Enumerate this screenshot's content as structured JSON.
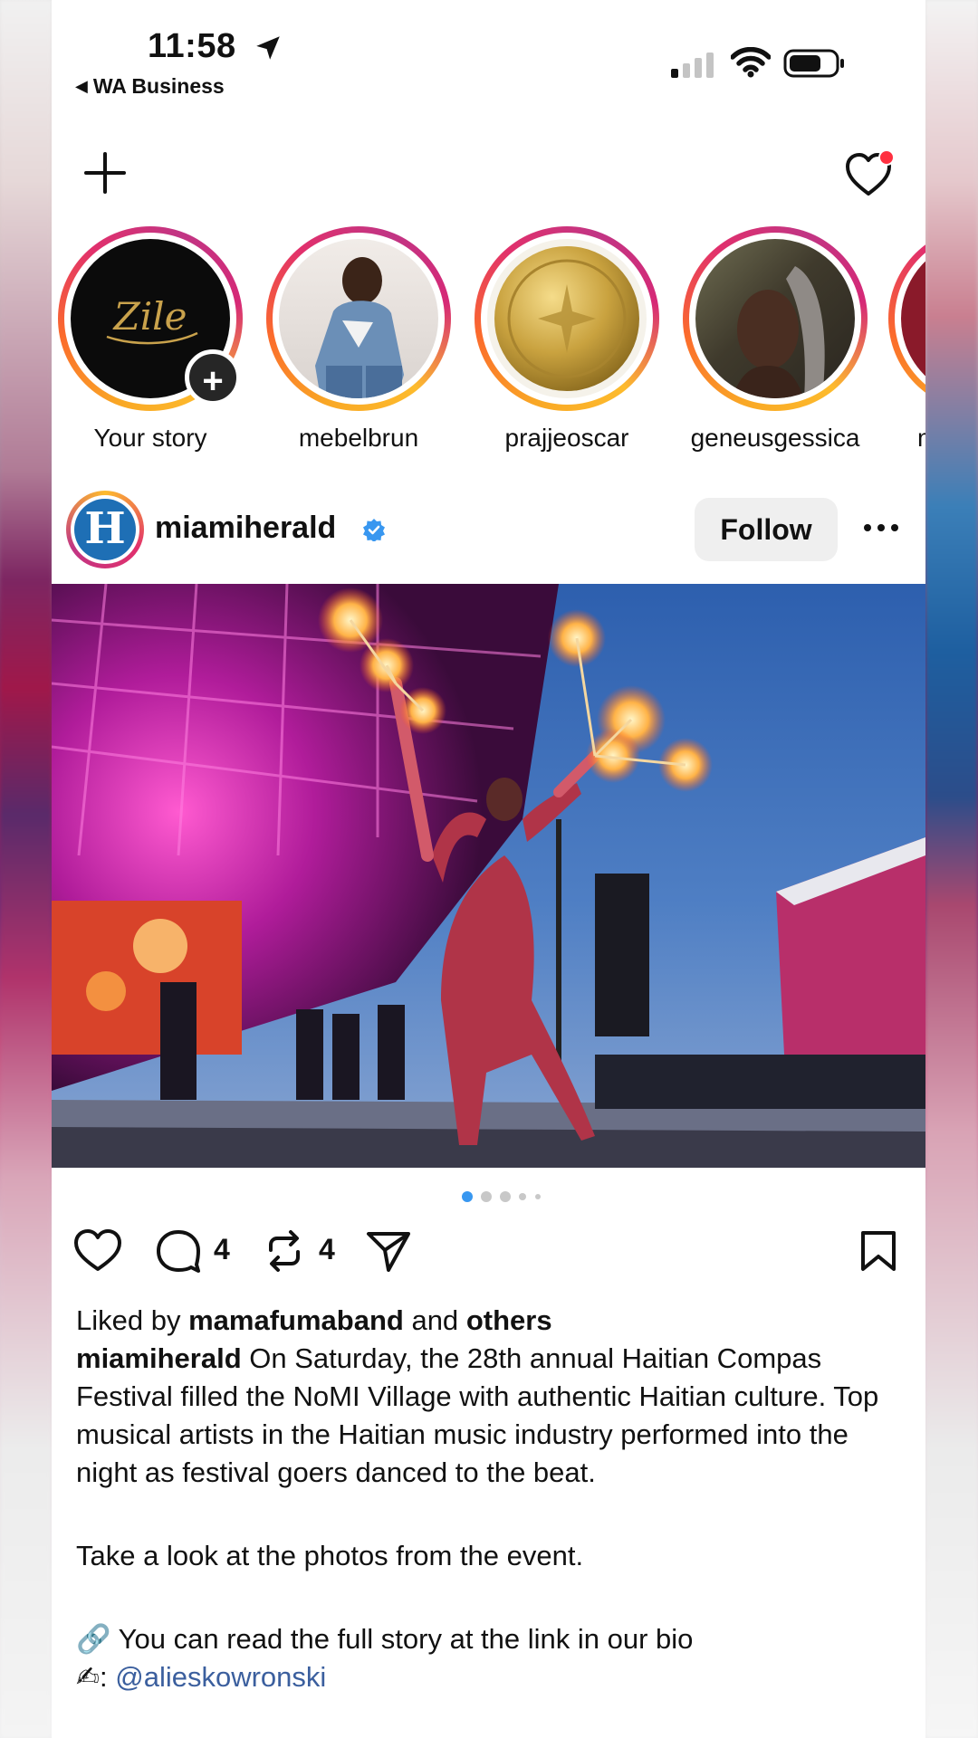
{
  "status_bar": {
    "time": "11:58",
    "back_label": "WA Business"
  },
  "stories": [
    {
      "username": "Your story",
      "avatar_text": "Zile"
    },
    {
      "username": "mebelbrun"
    },
    {
      "username": "prajjeoscar"
    },
    {
      "username": "geneusgessica"
    },
    {
      "username": "m"
    }
  ],
  "post": {
    "username": "miamiherald",
    "avatar_letter": "H",
    "follow_label": "Follow",
    "comment_count": "4",
    "repost_count": "4",
    "carousel": {
      "total_dots": 5,
      "active_index": 0
    },
    "liked_prefix": "Liked by",
    "liked_user": "mamafumaband",
    "liked_conj": "and",
    "liked_suffix": "others",
    "caption_text": "On Saturday, the 28th annual Haitian Compas Festival filled the NoMI Village with authentic Haitian culture. Top musical artists in the Haitian music industry performed into the night as festival goers danced to the beat.",
    "caption_line2": "Take a look at the photos from the event.",
    "caption_line3": "You can read the full story at the link in our bio",
    "caption_line3_emoji": "🔗",
    "caption_line4_emoji": "✍",
    "caption_line4_sep": ":",
    "caption_mention": "@alieskowronski"
  },
  "colors": {
    "accent_blue": "#3897f0",
    "notification_red": "#ff3040",
    "link": "#3b5f9e"
  }
}
